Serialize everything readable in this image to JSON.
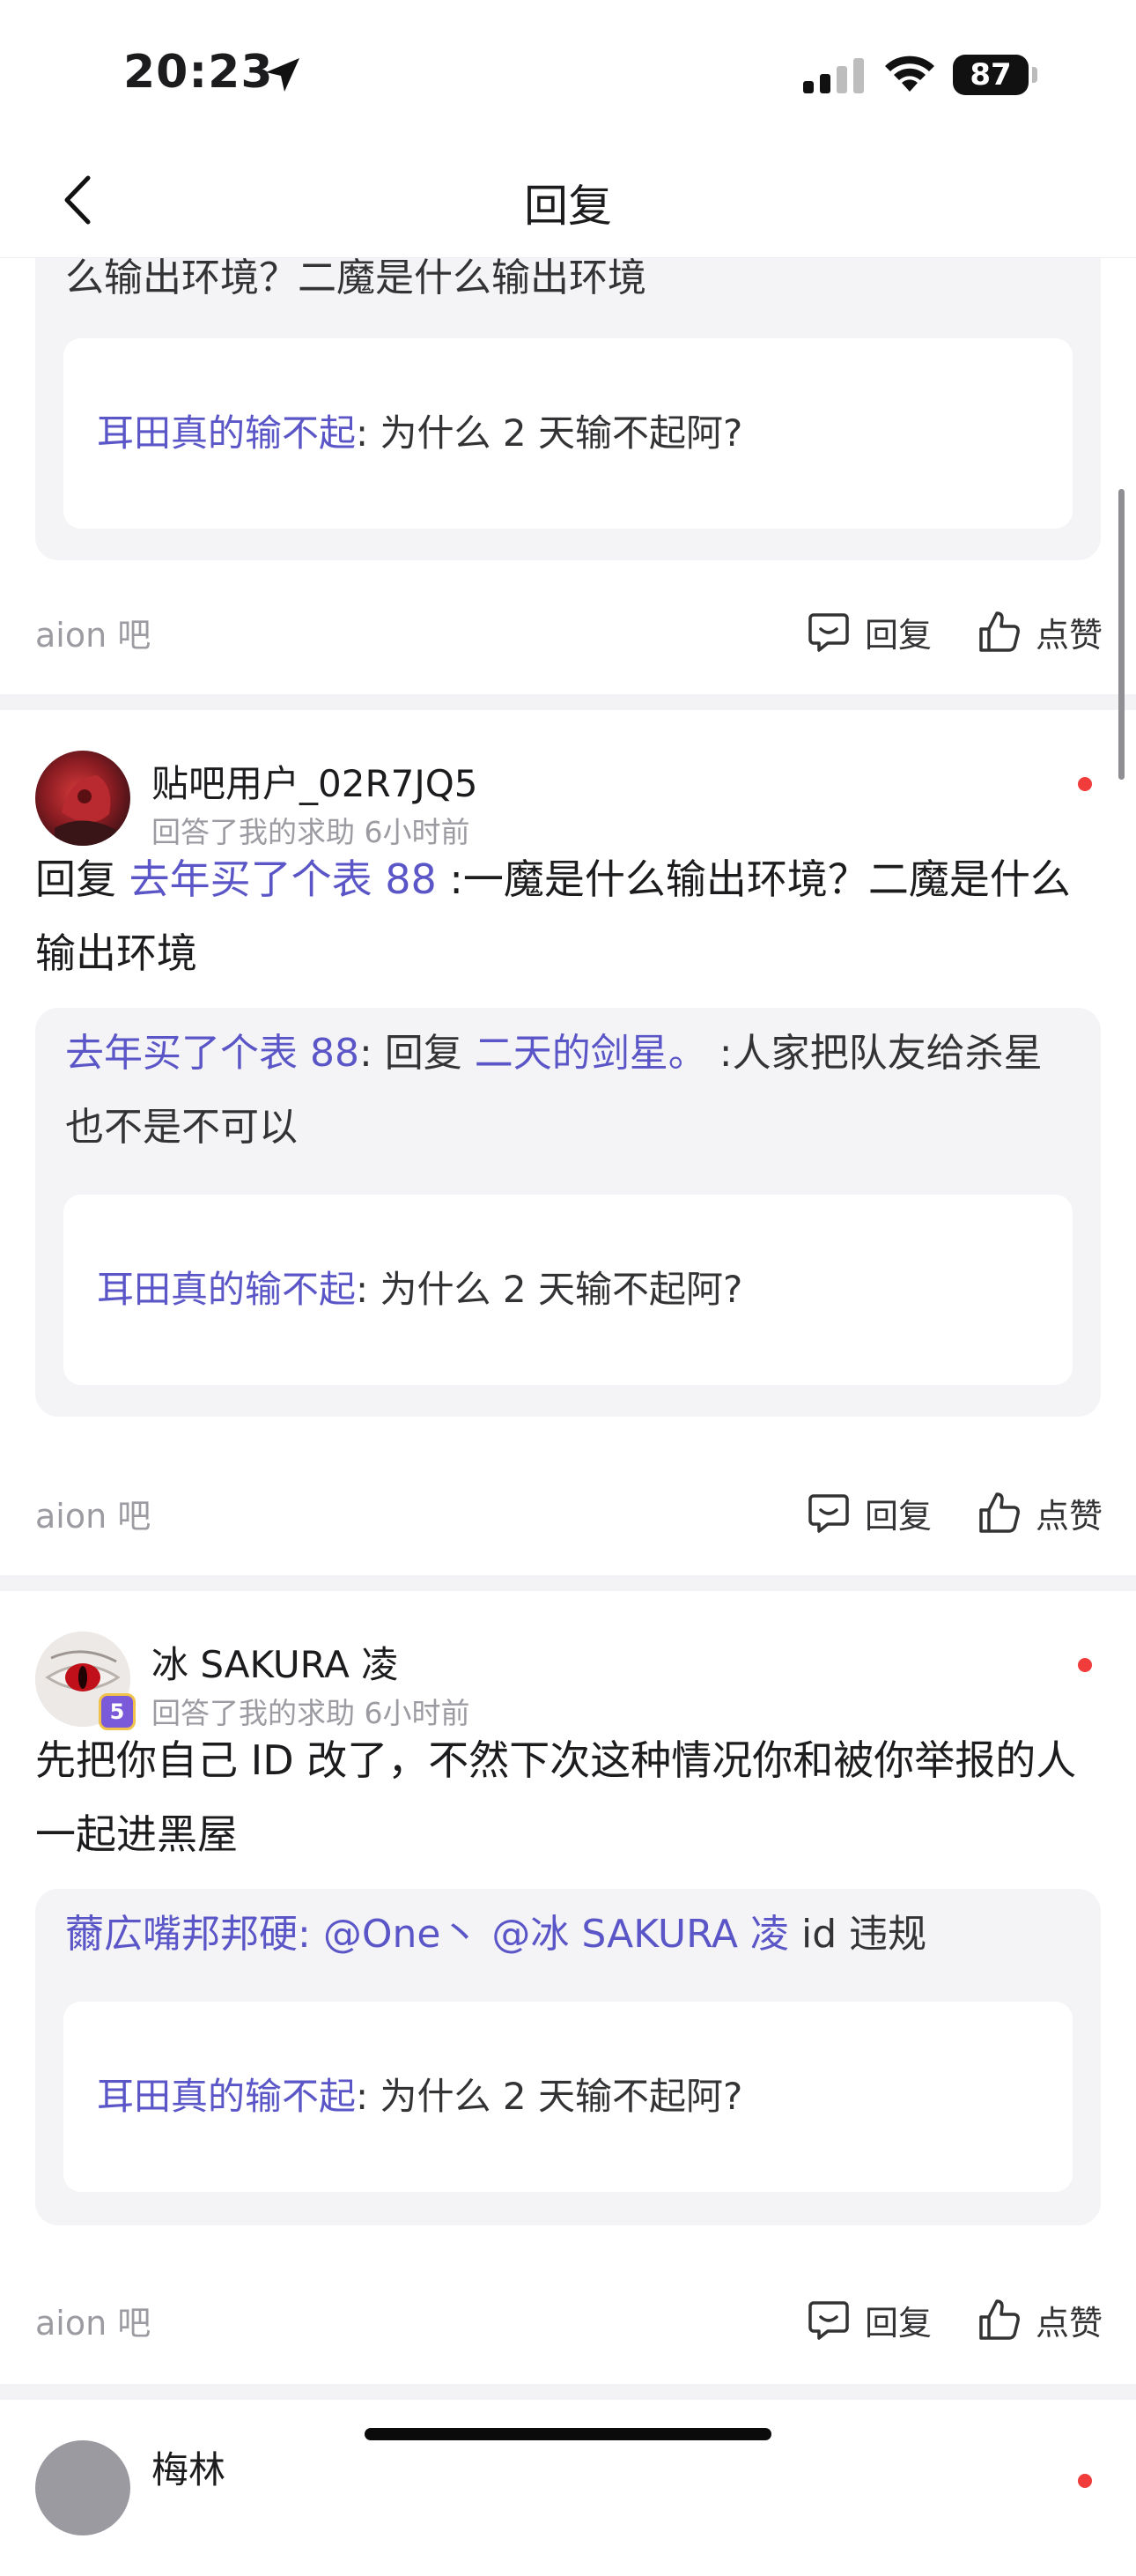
{
  "status_bar": {
    "time": "20:23",
    "battery": "87"
  },
  "nav": {
    "title": "回复"
  },
  "partial_card": {
    "quote_tail": "么输出环境？二魔是什么输出环境",
    "inner_user": "耳田真的输不起",
    "inner_text": ": 为什么 2 天输不起阿?",
    "forum": "aion 吧",
    "reply_label": "回复",
    "like_label": "点赞"
  },
  "cards": [
    {
      "username": "贴吧用户_02R7JQ5",
      "meta": "回答了我的求助  6小时前",
      "reply_prefix": "回复 ",
      "reply_mention": "去年买了个表 88",
      "reply_text": " :一魔是什么输出环境？二魔是什么输出环境",
      "quote_user": "去年买了个表 88",
      "quote_mid": ": 回复 ",
      "quote_mention": "二天的剑星。",
      "quote_text": " :人家把队友给杀星也不是不可以",
      "inner_user": "耳田真的输不起",
      "inner_text": ": 为什么 2 天输不起阿?",
      "forum": "aion 吧",
      "reply_label": "回复",
      "like_label": "点赞"
    },
    {
      "username": "冰 SAKURA 凌",
      "meta": "回答了我的求助  6小时前",
      "level_badge": "5",
      "reply_text": "先把你自己 ID 改了，不然下次这种情况你和被你举报的人一起进黑屋",
      "quote_user": "薾広嘴邦邦硬",
      "quote_mid": ": ",
      "quote_mention": "@One丶 @冰 SAKURA 凌",
      "quote_text": " id 违规",
      "inner_user": "耳田真的输不起",
      "inner_text": ": 为什么 2 天输不起阿?",
      "forum": "aion 吧",
      "reply_label": "回复",
      "like_label": "点赞"
    },
    {
      "username": "梅林"
    }
  ],
  "colors": {
    "link": "#5b56c7",
    "dot": "#f23c3c",
    "background": "#f4f4f7"
  }
}
